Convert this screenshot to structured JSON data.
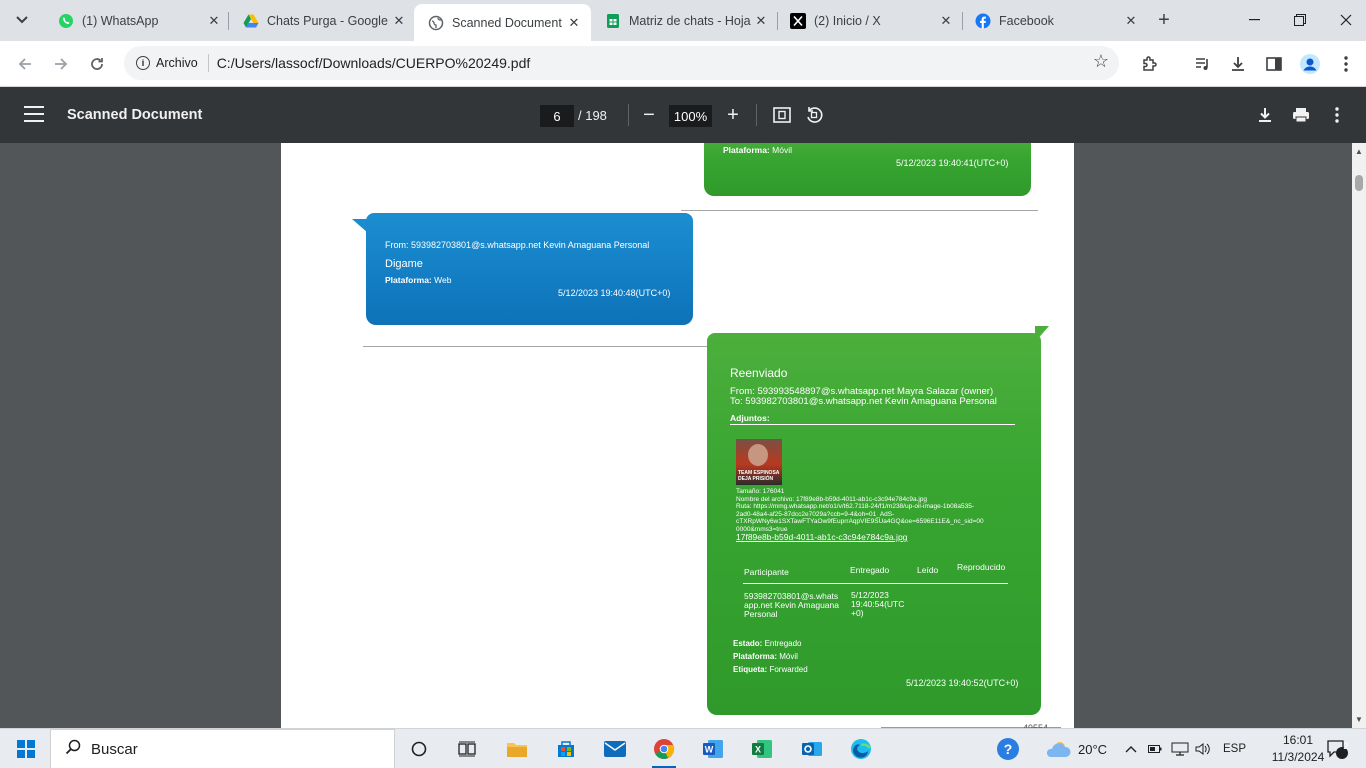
{
  "tabs": [
    {
      "title": "(1) WhatsApp",
      "icon": "whatsapp-icon"
    },
    {
      "title": "Chats Purga - Google Drive",
      "icon": "google-drive-icon"
    },
    {
      "title": "Scanned Document",
      "icon": "globe-icon"
    },
    {
      "title": "Matriz de chats - Hoja de cálculo",
      "icon": "google-sheets-icon"
    },
    {
      "title": "(2) Inicio / X",
      "icon": "x-logo-icon"
    },
    {
      "title": "Facebook",
      "icon": "facebook-icon"
    }
  ],
  "omnibox": {
    "chip_label": "Archivo",
    "url": "C:/Users/lassocf/Downloads/CUERPO%20249.pdf"
  },
  "pdf_viewer": {
    "title": "Scanned Document",
    "page_current": "6",
    "page_total": "/ 198",
    "zoom": "100%"
  },
  "document": {
    "top_bubble": {
      "platform_label": "Plataforma:",
      "platform_value": "Móvil",
      "timestamp": "5/12/2023 19:40:41(UTC+0)"
    },
    "blue_bubble": {
      "from": "From: 593982703801@s.whatsapp.net Kevin Amaguana Personal",
      "message": "Digame",
      "platform_label": "Plataforma:",
      "platform_value": "Web",
      "timestamp": "5/12/2023 19:40:48(UTC+0)"
    },
    "green_bubble": {
      "heading": "Reenviado",
      "from": "From: 593993548897@s.whatsapp.net Mayra Salazar (owner)",
      "to": "To: 593982703801@s.whatsapp.net Kevin Amaguana Personal",
      "attachments_label": "Adjuntos:",
      "image_caption": "TEAM ESPINOSA DEJA PRISIÓN",
      "size_line": "Tamaño: 176041",
      "file_name_line": "Nombre del archivo: 17f89e8b-b59d-4011-ab1c-c3c94e784c9a.jpg",
      "route_line1": "Ruta: https://mmg.whatsapp.net/o1/v/t62.7118-24/f1/m238/up-oil-image-1b08a535-",
      "route_line2": "2ad0-48a4-af25-87dcc2e7029a?ccb=9-4&oh=01_AdS-",
      "route_line3": "cTXRpWNy6w1SXTawFTYaOw9fEuprrAqpVIE9SUa4GQ&oe=6596E11E&_nc_sid=00",
      "route_line4": "0000&mms3=true",
      "file_link": "17f89e8b-b59d-4011-ab1c-c3c94e784c9a.jpg",
      "table_headers": [
        "Participante",
        "Entregado",
        "Leído",
        "Reproducido"
      ],
      "row_participant": [
        "593982703801@s.whats",
        "app.net Kevin Amaguana",
        "Personal"
      ],
      "row_delivered": [
        "5/12/2023",
        "19:40:54(UTC",
        "+0)"
      ],
      "status_label": "Estado:",
      "status_value": "Entregado",
      "platform_label": "Plataforma:",
      "platform_value": "Móvil",
      "tag_label": "Etiqueta:",
      "tag_value": "Forwarded",
      "timestamp": "5/12/2023 19:40:52(UTC+0)"
    },
    "page_stamp": "49554"
  },
  "taskbar": {
    "search_placeholder": "Buscar",
    "weather": "20°C",
    "language": "ESP",
    "time": "16:01",
    "date": "11/3/2024",
    "notifications": "2"
  },
  "colors": {
    "green_bubble": "#38a531",
    "blue_bubble": "#137dc3",
    "pdf_toolbar": "#323639",
    "doc_background": "#525659"
  }
}
